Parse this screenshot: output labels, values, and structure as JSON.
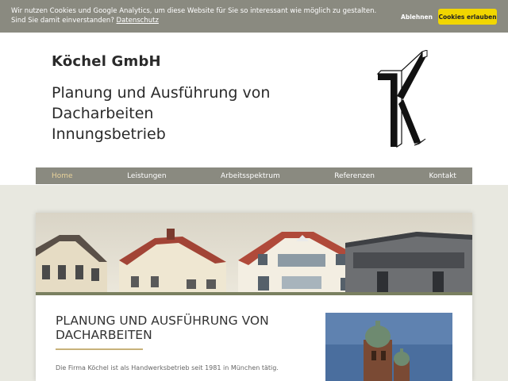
{
  "cookie": {
    "text": "Wir nutzen Cookies und Google Analytics, um diese Website für Sie so interessant wie möglich zu gestalten. Sind Sie damit einverstanden?",
    "link": "Datenschutz",
    "decline": "Ablehnen",
    "accept": "Cookies erlauben"
  },
  "header": {
    "company": "Köchel GmbH",
    "tagline_line1": "Planung und Ausführung von",
    "tagline_line2": "Dacharbeiten",
    "tagline_line3": "Innungsbetrieb"
  },
  "nav": {
    "items": [
      {
        "label": "Home"
      },
      {
        "label": "Leistungen"
      },
      {
        "label": "Arbeitsspektrum"
      },
      {
        "label": "Referenzen"
      },
      {
        "label": "Kontakt"
      }
    ]
  },
  "content": {
    "heading": "PLANUNG UND AUSFÜHRUNG VON DACHARBEITEN",
    "intro": "Die Firma Köchel ist als Handwerksbetrieb seit 1981 in München tätig."
  },
  "colors": {
    "bar": "#8a8a80",
    "accent_yellow": "#f1d600",
    "nav_active": "#e8d29a",
    "rule": "#c8b27a"
  }
}
